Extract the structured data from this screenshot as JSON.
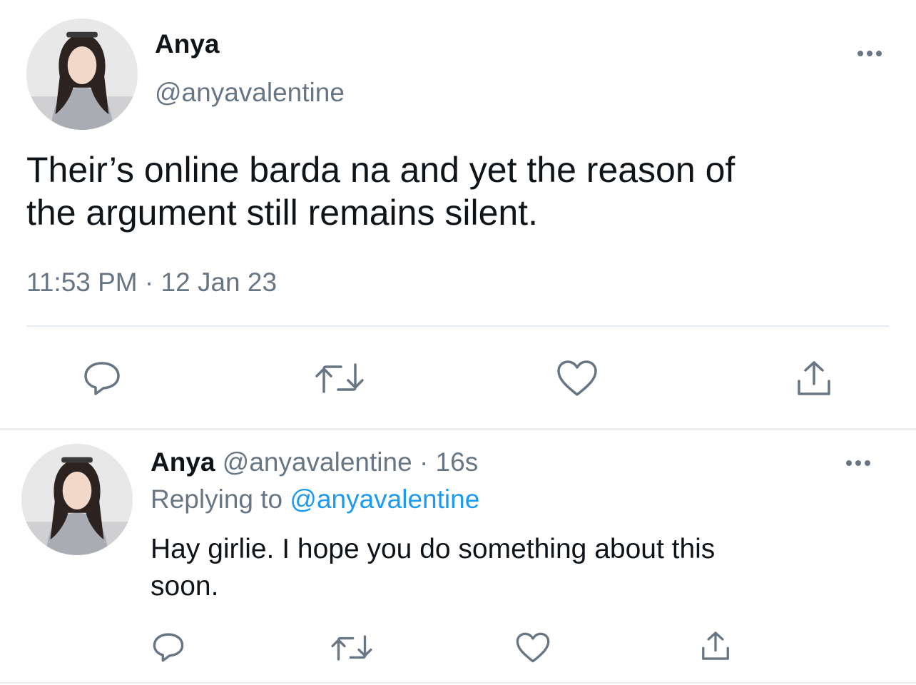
{
  "main_tweet": {
    "avatar_icon": "user-avatar-photo",
    "display_name": "Anya",
    "handle": "@anyavalentine",
    "more_icon": "more-options-icon",
    "text_line1": "Their’s online barda na and yet the reason of",
    "text_line2": "the argument still remains silent.",
    "timestamp": "11:53 PM · 12 Jan 23",
    "actions": [
      "reply-icon",
      "retweet-icon",
      "like-icon",
      "share-icon"
    ]
  },
  "reply_tweet": {
    "avatar_icon": "user-avatar-photo",
    "display_name": "Anya",
    "handle_time": "@anyavalentine · 16s",
    "replying_prefix": "Replying to",
    "replying_handle": "@anyavalentine",
    "text_line1": "Hay girlie. I hope you do something about this",
    "text_line2": "soon.",
    "actions": [
      "reply-icon",
      "retweet-icon",
      "like-icon",
      "share-icon"
    ]
  },
  "colors": {
    "text": "#0f1419",
    "secondary": "#687684",
    "link": "#1d9bf0",
    "divider": "#e6ecf0"
  }
}
